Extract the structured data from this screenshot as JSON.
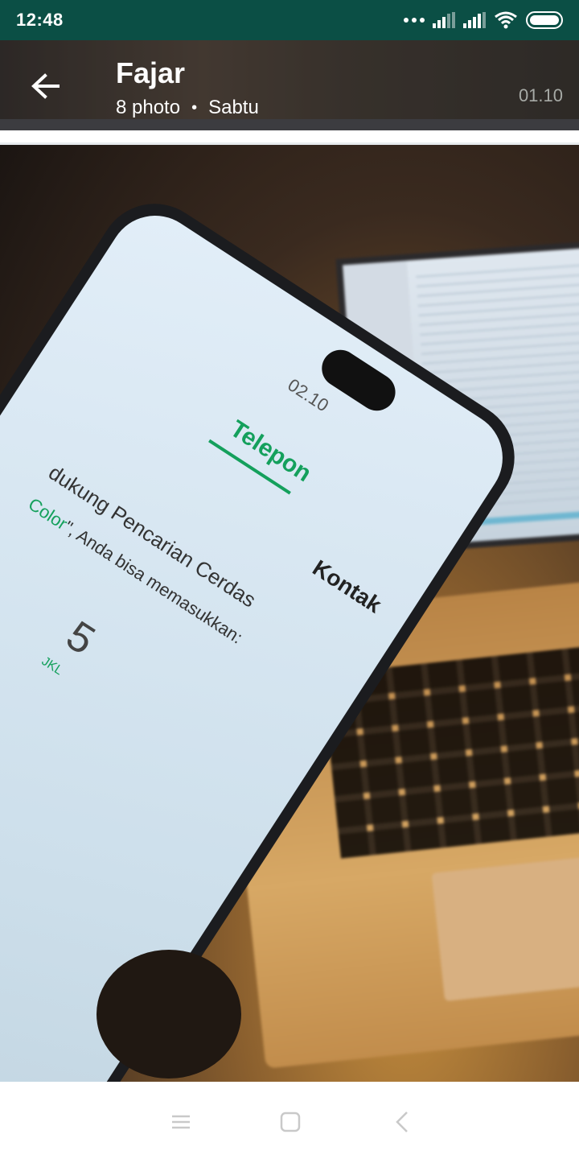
{
  "status_bar": {
    "time": "12:48",
    "icons": [
      "more-dots-icon",
      "signal-icon",
      "signal-icon",
      "wifi-icon",
      "battery-icon"
    ]
  },
  "header": {
    "title": "Fajar",
    "photo_count": "8 photo",
    "separator": "•",
    "day": "Sabtu",
    "time": "01.10",
    "back_icon": "arrow-left-icon"
  },
  "photo": {
    "phone_screen": {
      "time": "02.10",
      "tab_telepon": "Telepon",
      "tab_kontak": "Kontak",
      "line1": "dukung Pencarian Cerdas",
      "line2_green": "Color",
      "line2_rest": "\", Anda bisa memasukkan:",
      "digit": "5",
      "letters": "JKL"
    }
  },
  "nav_bar": {
    "menu_icon": "menu-icon",
    "home_icon": "home-square-icon",
    "back_icon": "back-chevron-icon"
  },
  "colors": {
    "status_bar": "#0b4f45",
    "accent_green": "#14a05c",
    "timestamp_gray": "#a7aaa6"
  }
}
